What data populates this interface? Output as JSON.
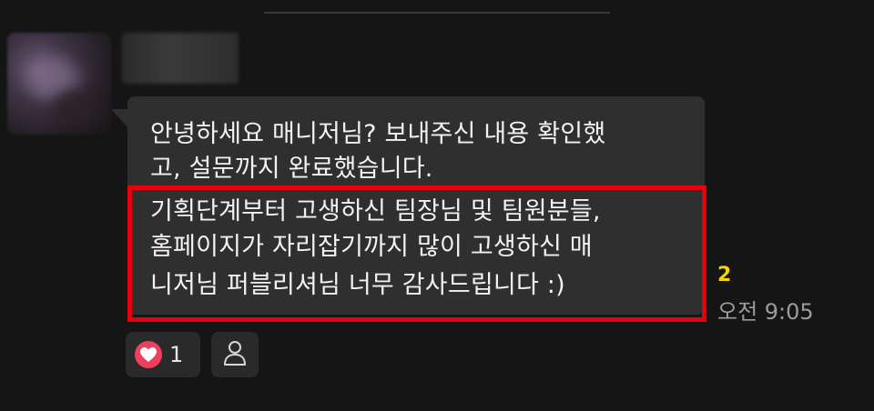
{
  "message": {
    "lines": [
      "안녕하세요 매니저님? 보내주신 내용 확인했",
      "고, 설문까지 완료했습니다.",
      "기획단계부터 고생하신 팀장님 및 팀원분들,",
      "홈페이지가 자리잡기까지 많이 고생하신 매",
      "니저님 퍼블리셔님 너무 감사드립니다 :)"
    ],
    "unread_count": "2",
    "time": "오전 9:05"
  },
  "reaction": {
    "icon": "heart-icon",
    "count": "1",
    "color": "#ef3f5c"
  },
  "profile_button": {
    "icon": "person-icon"
  },
  "colors": {
    "background": "#151515",
    "bubble": "#2f2f2f",
    "highlight": "#e8000c",
    "unread": "#f5d400",
    "timestamp": "#9c9c9c"
  }
}
